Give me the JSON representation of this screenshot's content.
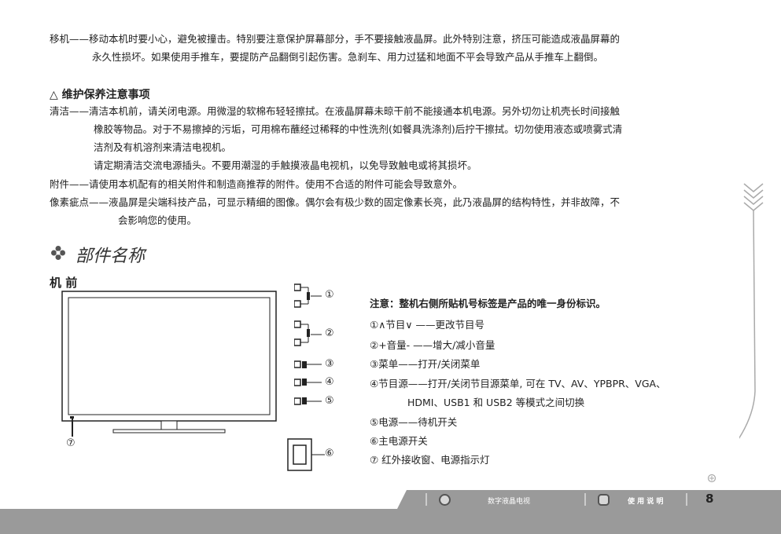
{
  "move": {
    "line1": "移机——移动本机时要小心，避免被撞击。特别要注意保护屏幕部分，手不要接触液晶屏。此外特别注意，挤压可能造成液晶屏幕的",
    "line2": "永久性损坏。如果使用手推车，要提防产品翻倒引起伤害。急刹车、用力过猛和地面不平会导致产品从手推车上翻倒。"
  },
  "maintenance": {
    "title": "△ 维护保养注意事项",
    "clean_1": "清洁——清洁本机前，请关闭电源。用微湿的软棉布轻轻擦拭。在液晶屏幕未晾干前不能接通本机电源。另外切勿让机壳长时间接触",
    "clean_2": "橡胶等物品。对于不易擦掉的污垢，可用棉布蘸经过稀释的中性洗剂(如餐具洗涤剂)后拧干擦拭。切勿使用液态或喷雾式清",
    "clean_3": "洁剂及有机溶剂来清洁电视机。",
    "clean_4": "请定期清洁交流电源插头。不要用潮湿的手触摸液晶电视机，以免导致触电或将其损坏。",
    "accessory": "附件——请使用本机配有的相关附件和制造商推荐的附件。使用不合适的附件可能会导致意外。",
    "pixel_1": "像素疵点——液晶屏是尖端科技产品，可显示精细的图像。偶尔会有极少数的固定像素长亮，此乃液晶屏的结构特性，并非故障，不",
    "pixel_2": "会影响您的使用。"
  },
  "parts": {
    "title": "部件名称",
    "front_label": "机 前",
    "callouts": [
      "①",
      "②",
      "③",
      "④",
      "⑤",
      "⑥",
      "⑦"
    ],
    "notes": [
      "注意：整机右侧所贴机号标签是产品的唯一身份标识。",
      "①∧节目∨ ——更改节目号",
      "②+音量- ——增大/减小音量",
      "③菜单——打开/关闭菜单",
      "④节目源——打开/关闭节目源菜单, 可在 TV、AV、YPBPR、VGA、",
      "HDMI、USB1 和 USB2 等模式之间切换",
      "⑤电源——待机开关",
      "⑥主电源开关",
      "⑦ 红外接收窗、电源指示灯"
    ]
  },
  "footer": {
    "product": "数字液晶电视",
    "manual": "使 用 说 明",
    "page": "8"
  },
  "colors": {
    "footer_gray": "#9a9a9a",
    "accent": "#4a4a4a"
  }
}
